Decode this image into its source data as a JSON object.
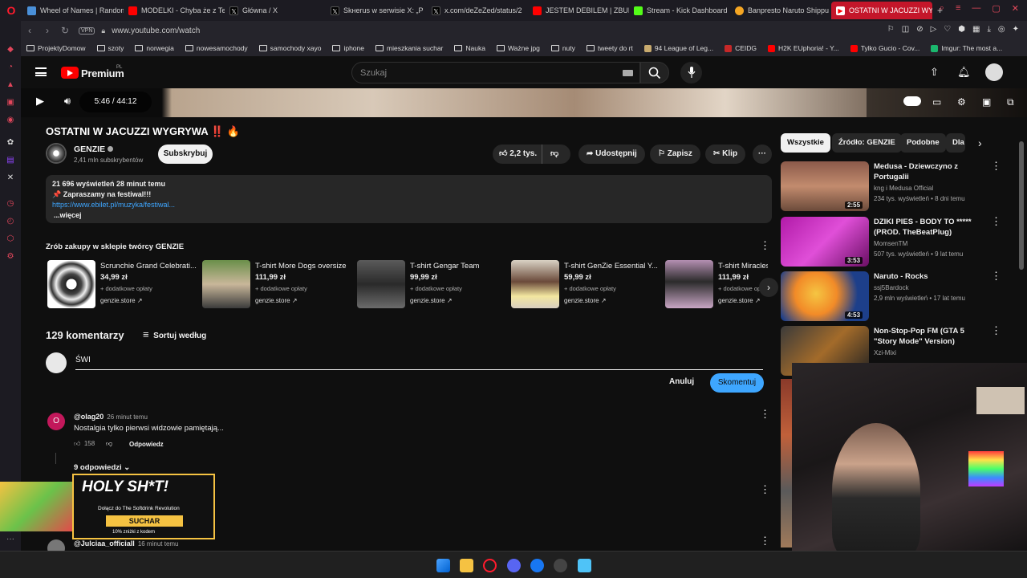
{
  "browser": {
    "tabs": [
      {
        "label": "Wheel of Names | Random",
        "icon_color": "#4a90d9"
      },
      {
        "label": "MODELKI - Chyba że z Te",
        "icon_color": "#ff0000"
      },
      {
        "label": "Główna / X",
        "icon_color": "#000000"
      },
      {
        "label": "Skнerus w serwisie X: „P",
        "icon_color": "#000000"
      },
      {
        "label": "x.com/deZeZed/status/2",
        "icon_color": "#000000"
      },
      {
        "label": "JESTEM DEBILEM | ZBUD",
        "icon_color": "#ff0000"
      },
      {
        "label": "Stream - Kick Dashboard",
        "icon_color": "#53fc18"
      },
      {
        "label": "Banpresto Naruto Shippu",
        "icon_color": "#f5a623"
      },
      {
        "label": "OSTATNI W JACUZZI WYG",
        "icon_color": "#ff0000",
        "active": true
      }
    ],
    "new_tab": "+",
    "url": "www.youtube.com/watch",
    "vpn": "VPN",
    "bookmarks": [
      {
        "label": "ProjektyDomow",
        "type": "folder"
      },
      {
        "label": "szoty",
        "type": "folder"
      },
      {
        "label": "norwegia",
        "type": "folder"
      },
      {
        "label": "nowesamochody",
        "type": "folder"
      },
      {
        "label": "samochody xayo",
        "type": "folder"
      },
      {
        "label": "iphone",
        "type": "folder"
      },
      {
        "label": "mieszkania suchar",
        "type": "folder"
      },
      {
        "label": "Nauka",
        "type": "folder"
      },
      {
        "label": "Ważne jpg",
        "type": "folder"
      },
      {
        "label": "nuty",
        "type": "folder"
      },
      {
        "label": "tweety do rt",
        "type": "folder"
      },
      {
        "label": "94 League of Leg...",
        "type": "site",
        "color": "#c8aa6e"
      },
      {
        "label": "CEIDG",
        "type": "site",
        "color": "#c62828"
      },
      {
        "label": "H2K EUphoria! - Y...",
        "type": "site",
        "color": "#ff0000"
      },
      {
        "label": "Tylko Gucio - Cov...",
        "type": "site",
        "color": "#ff0000"
      },
      {
        "label": "Imgur: The most a...",
        "type": "site",
        "color": "#1bb76e"
      }
    ]
  },
  "youtube": {
    "logo": "Premium",
    "region": "PL",
    "search_placeholder": "Szukaj",
    "player": {
      "time": "5:46 / 44:12"
    },
    "video": {
      "title": "OSTATNI W JACUZZI WYGRYWA",
      "title_emoji": "‼️ 🔥",
      "channel": "GENZIE",
      "subscribers": "2,41 mln subskrybentów",
      "subscribe": "Subskrybuj",
      "likes": "2,2 tys.",
      "share": "Udostępnij",
      "save": "Zapisz",
      "clip": "Klip"
    },
    "description": {
      "stats": "21 696 wyświetleń  28 minut temu",
      "line1": "📌 Zapraszamy na festiwal!!!",
      "link": "https://www.ebilet.pl/muzyka/festiwal...",
      "more": "...więcej"
    },
    "shop": {
      "heading": "Zrób zakupy w sklepie twórcy GENZIE",
      "products": [
        {
          "name": "Scrunchie Grand Celebrati...",
          "price": "34,99 zł",
          "extra": "+ dodatkowe opłaty",
          "store": "genzie.store"
        },
        {
          "name": "T-shirt More Dogs oversize",
          "price": "111,99 zł",
          "extra": "+ dodatkowe opłaty",
          "store": "genzie.store"
        },
        {
          "name": "T-shirt Gengar Team",
          "price": "99,99 zł",
          "extra": "+ dodatkowe opłaty",
          "store": "genzie.store"
        },
        {
          "name": "T-shirt GenZie Essential Y...",
          "price": "59,99 zł",
          "extra": "+ dodatkowe opłaty",
          "store": "genzie.store"
        },
        {
          "name": "T-shirt Miracles",
          "price": "111,99 zł",
          "extra": "+ dodatkowe opłaty",
          "store": "genzie.store"
        }
      ]
    },
    "comments": {
      "count": "129 komentarzy",
      "sort": "Sortuj według",
      "input_value": "ŚWI",
      "cancel": "Anuluj",
      "submit": "Skomentuj",
      "items": [
        {
          "author": "@olag20",
          "time": "26 minut temu",
          "text": "Nostalgia tylko pierwsi widzowie pamiętają...",
          "likes": "158",
          "reply": "Odpowiedz",
          "replies": "9 odpowiedzi",
          "initial": "O"
        },
        {
          "author": "@Julciaa_officiall",
          "time": "16 minut temu",
          "text": "",
          "initial": ""
        }
      ]
    },
    "chips": [
      "Wszystkie",
      "Źródło: GENZIE",
      "Podobne",
      "Dla"
    ],
    "recommended": [
      {
        "title": "Medusa - Dziewczyno z Portugalii",
        "channel": "kng i Medusa Official",
        "meta": "234 tys. wyświetleń • 8 dni temu",
        "duration": "2:55"
      },
      {
        "title": "DZIKI PIES - BODY TO ***** (PROD. TheBeatPlug)",
        "channel": "MomsenTM",
        "meta": "507 tys. wyświetleń • 9 lat temu",
        "duration": "3:53"
      },
      {
        "title": "Naruto - Rocks",
        "channel": "ssj5Bardock",
        "meta": "2,9 mln wyświetleń • 17 lat temu",
        "duration": "4:53"
      },
      {
        "title": "Non-Stop-Pop FM (GTA 5 \"Story Mode\" Version)",
        "channel": "Xzi-Mixi",
        "meta": "",
        "duration": ""
      }
    ]
  },
  "promo": {
    "headline": "HOLY SH*T!",
    "sub": "Dołącz do The Softdrink Revolution",
    "brand": "SUCHAR",
    "discount": "10% zniżki z kodem"
  },
  "colors": {
    "accent": "#3ea6ff",
    "brand_red": "#ff0000",
    "tab_active": "#c4162a"
  }
}
